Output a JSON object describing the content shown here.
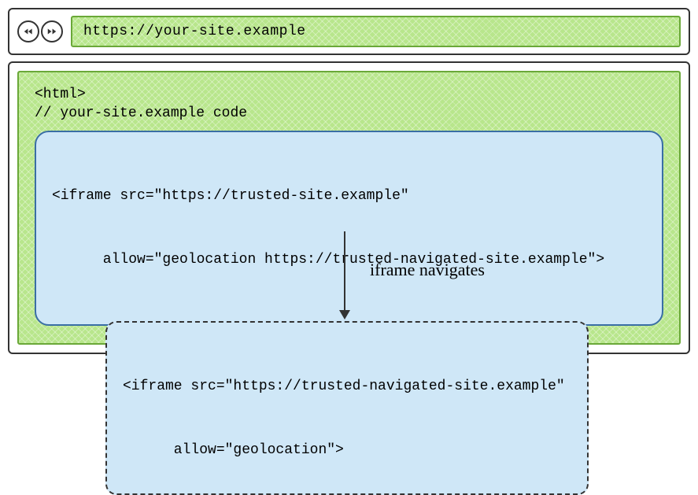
{
  "browser": {
    "url": "https://your-site.example"
  },
  "page": {
    "html_open": "<html>",
    "comment": "// your-site.example code",
    "iframe_line1": "<iframe src=\"https://trusted-site.example\"",
    "iframe_line2": "      allow=\"geolocation https://trusted-navigated-site.example\">"
  },
  "arrow": {
    "label": "iframe navigates"
  },
  "result": {
    "line1": "<iframe src=\"https://trusted-navigated-site.example\"",
    "line2": "      allow=\"geolocation\">"
  }
}
